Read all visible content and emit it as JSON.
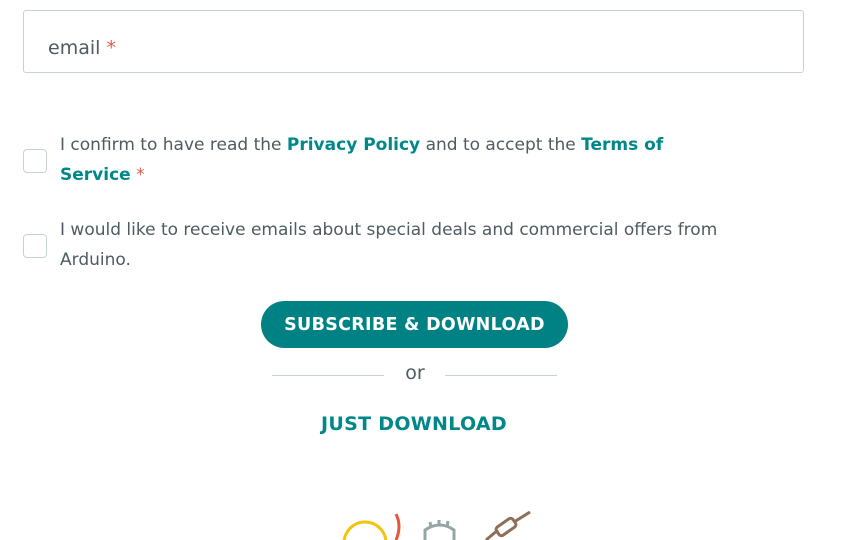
{
  "form": {
    "email_placeholder": "email",
    "required_mark": "*"
  },
  "consent": {
    "pre_text": "I confirm to have read the",
    "privacy_link": "Privacy Policy",
    "mid_text": "and to accept the",
    "terms_link_line1": "Terms of",
    "terms_link_line2": "Service",
    "required_mark": "*"
  },
  "marketing": {
    "line1": "I would like to receive emails about special deals and commercial offers from",
    "line2": "Arduino."
  },
  "actions": {
    "primary_label": "SUBSCRIBE & DOWNLOAD",
    "or_label": "or",
    "secondary_label": "JUST DOWNLOAD"
  },
  "colors": {
    "accent": "#008184",
    "link": "#00878a",
    "required": "#da5b4a",
    "text": "#4e5b61",
    "border": "#c9d2d3"
  },
  "icons": [
    "lightbulb-icon",
    "gear-icon",
    "resistor-icon"
  ]
}
